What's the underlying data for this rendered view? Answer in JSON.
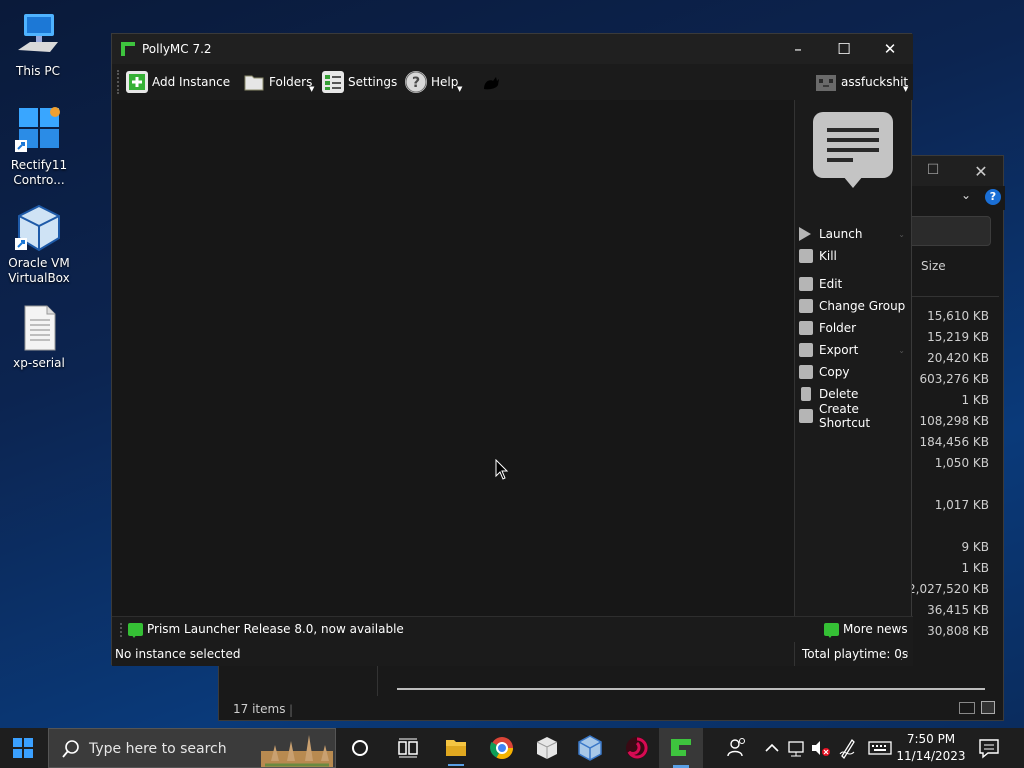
{
  "desktop": {
    "icons": [
      {
        "label": "This PC",
        "icon": "computer-icon"
      },
      {
        "label": "Rectify11 Contro...",
        "icon": "control-panel-icon"
      },
      {
        "label": "Oracle VM VirtualBox",
        "icon": "virtualbox-icon"
      },
      {
        "label": "xp-serial",
        "icon": "text-file-icon"
      }
    ]
  },
  "explorer": {
    "column_size": "Size",
    "sizes": [
      "15,610 KB",
      "15,219 KB",
      "20,420 KB",
      "603,276 KB",
      "1 KB",
      "108,298 KB",
      "184,456 KB",
      "1,050 KB",
      "",
      "1,017 KB",
      "",
      "9 KB",
      "1 KB",
      "2,027,520 KB",
      "36,415 KB",
      "30,808 KB"
    ],
    "status": "17 items"
  },
  "polly": {
    "title": "PollyMC 7.2",
    "toolbar": {
      "add_instance": "Add Instance",
      "folders": "Folders",
      "settings": "Settings",
      "help": "Help",
      "account": "assfuckshit"
    },
    "actions": [
      {
        "label": "Launch",
        "icon": "play-icon",
        "dropdown": true
      },
      {
        "label": "Kill",
        "icon": "kill-icon",
        "dropdown": false
      },
      {
        "label": "Edit",
        "icon": "edit-icon",
        "dropdown": false
      },
      {
        "label": "Change Group",
        "icon": "tag-icon",
        "dropdown": false
      },
      {
        "label": "Folder",
        "icon": "folder-icon",
        "dropdown": false
      },
      {
        "label": "Export",
        "icon": "export-icon",
        "dropdown": true
      },
      {
        "label": "Copy",
        "icon": "copy-icon",
        "dropdown": false
      },
      {
        "label": "Delete",
        "icon": "trash-icon",
        "dropdown": false
      },
      {
        "label": "Create Shortcut",
        "icon": "shortcut-icon",
        "dropdown": false
      }
    ],
    "news": "Prism Launcher Release 8.0, now available",
    "more_news": "More news",
    "status_left": "No instance selected",
    "status_right": "Total playtime: 0s"
  },
  "taskbar": {
    "search_placeholder": "Type here to search",
    "time": "7:50 PM",
    "date": "11/14/2023"
  },
  "colors": {
    "accent_green": "#35c035",
    "start_blue": "#3aa0ff"
  }
}
